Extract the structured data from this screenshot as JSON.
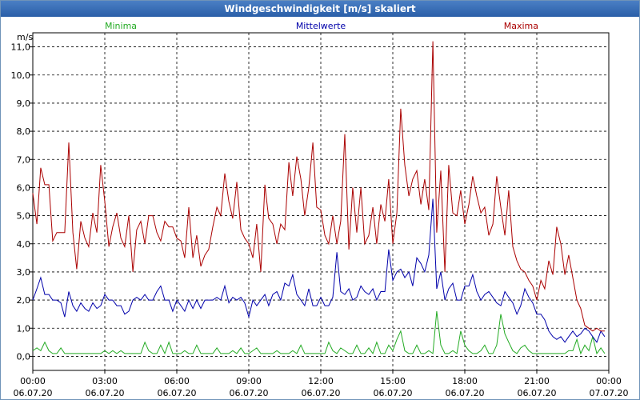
{
  "window": {
    "title": "Windgeschwindigkeit [m/s] skaliert"
  },
  "colors": {
    "minima": "#22aa22",
    "mittelwerte": "#0000aa",
    "maxima": "#aa0000",
    "grid": "#000000",
    "titlebar": "#2a5fa8"
  },
  "chart_data": {
    "type": "line",
    "title": "Windgeschwindigkeit [m/s] skaliert",
    "ylabel": "m/s",
    "xlabel": "",
    "ylim": [
      -0.5,
      11.5
    ],
    "xlim": [
      0,
      24
    ],
    "x_unit": "hours since 06.07.20 00:00",
    "yticks": [
      "0,0",
      "1,0",
      "2,0",
      "3,0",
      "4,0",
      "5,0",
      "6,0",
      "7,0",
      "8,0",
      "9,0",
      "10,0",
      "11,0"
    ],
    "xticks": [
      {
        "time": "00:00",
        "date": "06.07.20"
      },
      {
        "time": "03:00",
        "date": "06.07.20"
      },
      {
        "time": "06:00",
        "date": "06.07.20"
      },
      {
        "time": "09:00",
        "date": "06.07.20"
      },
      {
        "time": "12:00",
        "date": "06.07.20"
      },
      {
        "time": "15:00",
        "date": "06.07.20"
      },
      {
        "time": "18:00",
        "date": "06.07.20"
      },
      {
        "time": "21:00",
        "date": "06.07.20"
      },
      {
        "time": "00:00",
        "date": "07.07.20"
      }
    ],
    "grid": true,
    "legend": [
      "Minima",
      "Mittelwerte",
      "Maxima"
    ],
    "series": [
      {
        "name": "Minima",
        "x": [
          0,
          0.17,
          0.33,
          0.5,
          0.67,
          0.83,
          1.0,
          1.17,
          1.33,
          1.5,
          1.67,
          1.83,
          2.0,
          2.17,
          2.33,
          2.5,
          2.67,
          2.83,
          3.0,
          3.17,
          3.33,
          3.5,
          3.67,
          3.83,
          4.0,
          4.17,
          4.33,
          4.5,
          4.67,
          4.83,
          5.0,
          5.17,
          5.33,
          5.5,
          5.67,
          5.83,
          6.0,
          6.17,
          6.33,
          6.5,
          6.67,
          6.83,
          7.0,
          7.17,
          7.33,
          7.5,
          7.67,
          7.83,
          8.0,
          8.17,
          8.33,
          8.5,
          8.67,
          8.83,
          9.0,
          9.17,
          9.33,
          9.5,
          9.67,
          9.83,
          10.0,
          10.17,
          10.33,
          10.5,
          10.67,
          10.83,
          11.0,
          11.17,
          11.33,
          11.5,
          11.67,
          11.83,
          12.0,
          12.17,
          12.33,
          12.5,
          12.67,
          12.83,
          13.0,
          13.17,
          13.33,
          13.5,
          13.67,
          13.83,
          14.0,
          14.17,
          14.33,
          14.5,
          14.67,
          14.83,
          15.0,
          15.17,
          15.33,
          15.5,
          15.67,
          15.83,
          16.0,
          16.17,
          16.33,
          16.5,
          16.67,
          16.83,
          17.0,
          17.17,
          17.33,
          17.5,
          17.67,
          17.83,
          18.0,
          18.17,
          18.33,
          18.5,
          18.67,
          18.83,
          19.0,
          19.17,
          19.33,
          19.5,
          19.67,
          19.83,
          20.0,
          20.17,
          20.33,
          20.5,
          20.67,
          20.83,
          21.0,
          21.17,
          21.33,
          21.5,
          21.67,
          21.83,
          22.0,
          22.17,
          22.33,
          22.5,
          22.67,
          22.83,
          23.0,
          23.17,
          23.33,
          23.5,
          23.67,
          23.83
        ],
        "values": [
          0.2,
          0.3,
          0.2,
          0.5,
          0.2,
          0.1,
          0.1,
          0.3,
          0.1,
          0.1,
          0.1,
          0.1,
          0.1,
          0.1,
          0.1,
          0.1,
          0.1,
          0.1,
          0.2,
          0.1,
          0.2,
          0.1,
          0.2,
          0.1,
          0.1,
          0.1,
          0.1,
          0.1,
          0.5,
          0.2,
          0.1,
          0.1,
          0.4,
          0.1,
          0.5,
          0.1,
          0.1,
          0.1,
          0.2,
          0.1,
          0.1,
          0.4,
          0.1,
          0.1,
          0.1,
          0.1,
          0.3,
          0.1,
          0.1,
          0.1,
          0.2,
          0.1,
          0.3,
          0.1,
          0.1,
          0.2,
          0.3,
          0.1,
          0.1,
          0.1,
          0.1,
          0.2,
          0.1,
          0.1,
          0.1,
          0.2,
          0.1,
          0.4,
          0.1,
          0.1,
          0.1,
          0.1,
          0.1,
          0.1,
          0.5,
          0.2,
          0.1,
          0.3,
          0.2,
          0.1,
          0.1,
          0.4,
          0.1,
          0.1,
          0.3,
          0.1,
          0.5,
          0.1,
          0.1,
          0.4,
          0.2,
          0.6,
          0.9,
          0.2,
          0.1,
          0.1,
          0.4,
          0.1,
          0.1,
          0.2,
          0.1,
          1.6,
          0.4,
          0.1,
          0.1,
          0.2,
          0.1,
          0.9,
          0.4,
          0.2,
          0.1,
          0.1,
          0.2,
          0.4,
          0.1,
          0.1,
          0.4,
          1.5,
          0.8,
          0.5,
          0.2,
          0.1,
          0.3,
          0.4,
          0.2,
          0.1,
          0.1,
          0.1,
          0.1,
          0.1,
          0.1,
          0.1,
          0.1,
          0.1,
          0.2,
          0.2,
          0.6,
          0.1,
          0.4,
          0.2,
          0.7,
          0.1,
          0.3,
          0.1
        ],
        "color": "#22aa22"
      },
      {
        "name": "Mittelwerte",
        "x": [
          0,
          0.17,
          0.33,
          0.5,
          0.67,
          0.83,
          1.0,
          1.17,
          1.33,
          1.5,
          1.67,
          1.83,
          2.0,
          2.17,
          2.33,
          2.5,
          2.67,
          2.83,
          3.0,
          3.17,
          3.33,
          3.5,
          3.67,
          3.83,
          4.0,
          4.17,
          4.33,
          4.5,
          4.67,
          4.83,
          5.0,
          5.17,
          5.33,
          5.5,
          5.67,
          5.83,
          6.0,
          6.17,
          6.33,
          6.5,
          6.67,
          6.83,
          7.0,
          7.17,
          7.33,
          7.5,
          7.67,
          7.83,
          8.0,
          8.17,
          8.33,
          8.5,
          8.67,
          8.83,
          9.0,
          9.17,
          9.33,
          9.5,
          9.67,
          9.83,
          10.0,
          10.17,
          10.33,
          10.5,
          10.67,
          10.83,
          11.0,
          11.17,
          11.33,
          11.5,
          11.67,
          11.83,
          12.0,
          12.17,
          12.33,
          12.5,
          12.67,
          12.83,
          13.0,
          13.17,
          13.33,
          13.5,
          13.67,
          13.83,
          14.0,
          14.17,
          14.33,
          14.5,
          14.67,
          14.83,
          15.0,
          15.17,
          15.33,
          15.5,
          15.67,
          15.83,
          16.0,
          16.17,
          16.33,
          16.5,
          16.67,
          16.83,
          17.0,
          17.17,
          17.33,
          17.5,
          17.67,
          17.83,
          18.0,
          18.17,
          18.33,
          18.5,
          18.67,
          18.83,
          19.0,
          19.17,
          19.33,
          19.5,
          19.67,
          19.83,
          20.0,
          20.17,
          20.33,
          20.5,
          20.67,
          20.83,
          21.0,
          21.17,
          21.33,
          21.5,
          21.67,
          21.83,
          22.0,
          22.17,
          22.33,
          22.5,
          22.67,
          22.83,
          23.0,
          23.17,
          23.33,
          23.5,
          23.67,
          23.83
        ],
        "values": [
          2.0,
          2.4,
          2.8,
          2.2,
          2.2,
          2.0,
          2.0,
          1.9,
          1.4,
          2.3,
          1.8,
          1.6,
          1.9,
          1.7,
          1.6,
          1.9,
          1.7,
          1.8,
          2.2,
          2.0,
          2.0,
          1.8,
          1.8,
          1.5,
          1.6,
          2.0,
          2.1,
          2.0,
          2.2,
          2.0,
          2.0,
          2.3,
          2.5,
          2.0,
          2.0,
          1.6,
          2.0,
          1.8,
          1.6,
          2.0,
          1.7,
          2.0,
          1.7,
          2.0,
          2.0,
          2.0,
          2.1,
          2.0,
          2.5,
          1.9,
          2.1,
          2.0,
          2.1,
          1.9,
          1.4,
          2.0,
          1.8,
          2.0,
          2.2,
          1.8,
          2.2,
          2.3,
          2.0,
          2.6,
          2.5,
          2.9,
          2.2,
          2.0,
          1.8,
          2.4,
          1.8,
          1.8,
          2.1,
          1.8,
          1.8,
          2.1,
          3.7,
          2.3,
          2.2,
          2.4,
          2.0,
          2.1,
          2.5,
          2.3,
          2.2,
          2.4,
          2.0,
          2.3,
          2.3,
          3.8,
          2.7,
          3.0,
          3.1,
          2.8,
          3.0,
          2.5,
          3.5,
          3.3,
          3.0,
          3.6,
          5.6,
          2.4,
          3.0,
          2.0,
          2.4,
          2.6,
          2.0,
          2.0,
          2.5,
          2.5,
          2.9,
          2.3,
          2.0,
          2.2,
          2.3,
          2.1,
          1.9,
          1.8,
          2.3,
          2.1,
          1.9,
          1.5,
          1.8,
          2.4,
          2.1,
          1.9,
          1.5,
          1.5,
          1.3,
          0.9,
          0.7,
          0.6,
          0.7,
          0.5,
          0.7,
          0.9,
          0.7,
          0.8,
          1.0,
          0.9,
          0.7,
          0.5,
          0.9,
          0.7
        ],
        "color": "#0000aa"
      },
      {
        "name": "Maxima",
        "x": [
          0,
          0.17,
          0.33,
          0.5,
          0.67,
          0.83,
          1.0,
          1.17,
          1.33,
          1.5,
          1.67,
          1.83,
          2.0,
          2.17,
          2.33,
          2.5,
          2.67,
          2.83,
          3.0,
          3.17,
          3.33,
          3.5,
          3.67,
          3.83,
          4.0,
          4.17,
          4.33,
          4.5,
          4.67,
          4.83,
          5.0,
          5.17,
          5.33,
          5.5,
          5.67,
          5.83,
          6.0,
          6.17,
          6.33,
          6.5,
          6.67,
          6.83,
          7.0,
          7.17,
          7.33,
          7.5,
          7.67,
          7.83,
          8.0,
          8.17,
          8.33,
          8.5,
          8.67,
          8.83,
          9.0,
          9.17,
          9.33,
          9.5,
          9.67,
          9.83,
          10.0,
          10.17,
          10.33,
          10.5,
          10.67,
          10.83,
          11.0,
          11.17,
          11.33,
          11.5,
          11.67,
          11.83,
          12.0,
          12.17,
          12.33,
          12.5,
          12.67,
          12.83,
          13.0,
          13.17,
          13.33,
          13.5,
          13.67,
          13.83,
          14.0,
          14.17,
          14.33,
          14.5,
          14.67,
          14.83,
          15.0,
          15.17,
          15.33,
          15.5,
          15.67,
          15.83,
          16.0,
          16.17,
          16.33,
          16.5,
          16.67,
          16.83,
          17.0,
          17.17,
          17.33,
          17.5,
          17.67,
          17.83,
          18.0,
          18.17,
          18.33,
          18.5,
          18.67,
          18.83,
          19.0,
          19.17,
          19.33,
          19.5,
          19.67,
          19.83,
          20.0,
          20.17,
          20.33,
          20.5,
          20.67,
          20.83,
          21.0,
          21.17,
          21.33,
          21.5,
          21.67,
          21.83,
          22.0,
          22.17,
          22.33,
          22.5,
          22.67,
          22.83,
          23.0,
          23.17,
          23.33,
          23.5,
          23.67,
          23.83
        ],
        "values": [
          5.8,
          4.7,
          6.7,
          6.1,
          6.1,
          4.1,
          4.4,
          4.4,
          4.4,
          7.6,
          4.4,
          3.1,
          4.8,
          4.2,
          3.9,
          5.1,
          4.4,
          6.8,
          5.5,
          3.9,
          4.6,
          5.1,
          4.2,
          3.9,
          5.0,
          3.0,
          4.5,
          4.8,
          4.0,
          5.0,
          5.0,
          4.4,
          4.1,
          4.8,
          4.6,
          4.6,
          4.2,
          4.1,
          3.5,
          5.3,
          3.5,
          4.3,
          3.2,
          3.6,
          3.8,
          4.6,
          5.3,
          5.0,
          6.5,
          5.5,
          4.9,
          6.2,
          4.5,
          4.2,
          4.0,
          3.5,
          4.7,
          3.0,
          6.1,
          4.9,
          4.7,
          4.0,
          4.7,
          4.5,
          6.9,
          5.7,
          7.1,
          6.3,
          5.0,
          6.0,
          7.6,
          5.3,
          5.2,
          4.3,
          4.0,
          5.0,
          4.0,
          4.8,
          7.9,
          3.8,
          6.0,
          4.4,
          6.0,
          4.0,
          4.3,
          5.3,
          4.0,
          5.4,
          4.8,
          6.3,
          4.0,
          5.1,
          8.8,
          6.8,
          5.7,
          6.3,
          6.6,
          5.4,
          6.3,
          5.2,
          11.2,
          4.4,
          6.6,
          3.0,
          6.8,
          5.1,
          5.0,
          5.9,
          4.7,
          5.4,
          6.4,
          5.7,
          5.1,
          5.3,
          4.3,
          4.7,
          6.4,
          5.3,
          4.3,
          5.9,
          3.9,
          3.4,
          3.1,
          3.0,
          2.7,
          2.5,
          2.0,
          2.7,
          2.4,
          3.4,
          2.9,
          4.6,
          4.0,
          2.9,
          3.6,
          2.8,
          2.0,
          1.7,
          1.1,
          1.0,
          0.9,
          1.0,
          0.9,
          0.9
        ],
        "color": "#aa0000"
      }
    ]
  }
}
